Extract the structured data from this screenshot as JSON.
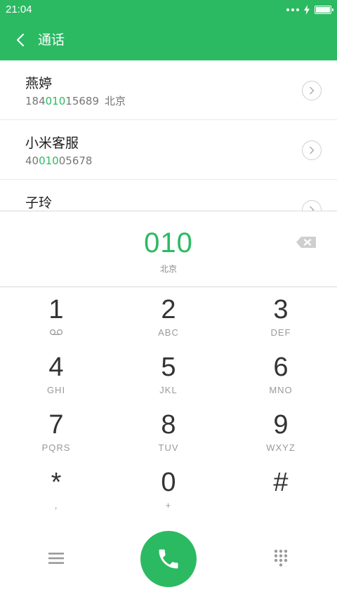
{
  "status_bar": {
    "time": "21:04",
    "battery_level": 1.0
  },
  "header": {
    "title": "通话"
  },
  "contacts": [
    {
      "name": "燕婷",
      "number_prefix": "184",
      "number_match": "010",
      "number_suffix": "15689",
      "location": "北京"
    },
    {
      "name": "小米客服",
      "number_prefix": "40",
      "number_match": "010",
      "number_suffix": "05678",
      "location": ""
    },
    {
      "name": "子玲",
      "number_prefix": "",
      "number_match": "",
      "number_suffix": "",
      "location": ""
    }
  ],
  "dial": {
    "number": "010",
    "region": "北京"
  },
  "keys": [
    {
      "digit": "1",
      "letters": ""
    },
    {
      "digit": "2",
      "letters": "ABC"
    },
    {
      "digit": "3",
      "letters": "DEF"
    },
    {
      "digit": "4",
      "letters": "GHI"
    },
    {
      "digit": "5",
      "letters": "JKL"
    },
    {
      "digit": "6",
      "letters": "MNO"
    },
    {
      "digit": "7",
      "letters": "PQRS"
    },
    {
      "digit": "8",
      "letters": "TUV"
    },
    {
      "digit": "9",
      "letters": "WXYZ"
    },
    {
      "digit": "*",
      "letters": ","
    },
    {
      "digit": "0",
      "letters": "+"
    },
    {
      "digit": "#",
      "letters": ""
    }
  ],
  "colors": {
    "accent": "#2bba62",
    "text": "#333333",
    "subtext": "#999999"
  },
  "icons": {
    "back": "chevron-left-icon",
    "arrow": "chevron-right-circle-icon",
    "backspace": "backspace-icon",
    "voicemail": "voicemail-icon",
    "menu": "menu-icon",
    "call": "phone-icon",
    "dialpad": "dialpad-icon"
  }
}
